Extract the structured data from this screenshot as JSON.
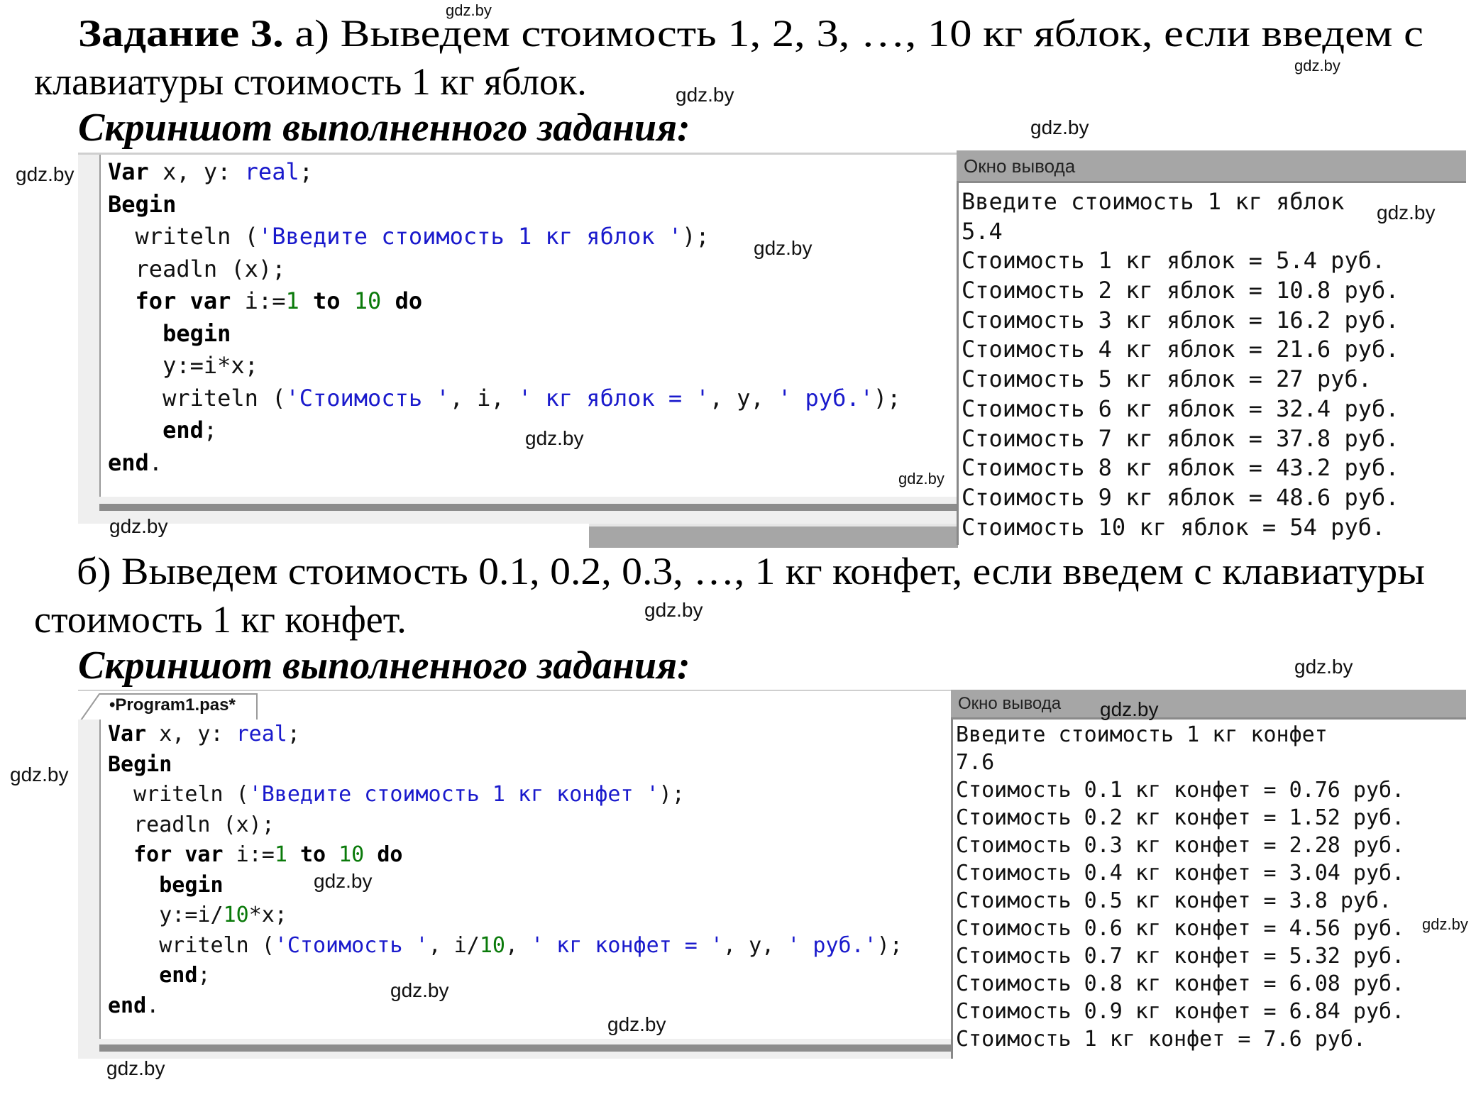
{
  "task": {
    "title_bold": "Задание 3.",
    "part_a_line1": " а) Выведем стоимость 1, 2, 3, …, 10 кг яблок, если введем с",
    "part_a_line2": "клавиатуры стоимость 1 кг яблок.",
    "screenshot_heading": "Скриншот выполненного задания:",
    "part_b_line1": "б) Выведем стоимость 0.1, 0.2, 0.3, …, 1 кг конфет, если введем с клавиатуры",
    "part_b_line2": "стоимость 1 кг конфет."
  },
  "watermark": "gdz.by",
  "section_a": {
    "code": [
      [
        {
          "t": "Var",
          "c": "kw"
        },
        {
          "t": " x, y: "
        },
        {
          "t": "real",
          "c": "typ"
        },
        {
          "t": ";"
        }
      ],
      [
        {
          "t": "Begin",
          "c": "kw"
        }
      ],
      [
        {
          "t": "  writeln ("
        },
        {
          "t": "'Введите стоимость 1 кг яблок '",
          "c": "str"
        },
        {
          "t": ");"
        }
      ],
      [
        {
          "t": "  readln (x);"
        }
      ],
      [
        {
          "t": "  "
        },
        {
          "t": "for var",
          "c": "kw"
        },
        {
          "t": " i:="
        },
        {
          "t": "1",
          "c": "num"
        },
        {
          "t": " "
        },
        {
          "t": "to",
          "c": "kw"
        },
        {
          "t": " "
        },
        {
          "t": "10",
          "c": "num"
        },
        {
          "t": " "
        },
        {
          "t": "do",
          "c": "kw"
        }
      ],
      [
        {
          "t": "    "
        },
        {
          "t": "begin",
          "c": "kw"
        }
      ],
      [
        {
          "t": "    y:=i*x;"
        }
      ],
      [
        {
          "t": "    writeln ("
        },
        {
          "t": "'Стоимость '",
          "c": "str"
        },
        {
          "t": ", i, "
        },
        {
          "t": "' кг яблок = '",
          "c": "str"
        },
        {
          "t": ", y, "
        },
        {
          "t": "' руб.'",
          "c": "str"
        },
        {
          "t": ");"
        }
      ],
      [
        {
          "t": "    "
        },
        {
          "t": "end",
          "c": "kw"
        },
        {
          "t": ";"
        }
      ],
      [
        {
          "t": "end",
          "c": "kw"
        },
        {
          "t": "."
        }
      ]
    ],
    "output_title": "Окно вывода",
    "output_lines": [
      "Введите стоимость 1 кг яблок",
      "5.4",
      "Стоимость 1 кг яблок = 5.4 руб.",
      "Стоимость 2 кг яблок = 10.8 руб.",
      "Стоимость 3 кг яблок = 16.2 руб.",
      "Стоимость 4 кг яблок = 21.6 руб.",
      "Стоимость 5 кг яблок = 27 руб.",
      "Стоимость 6 кг яблок = 32.4 руб.",
      "Стоимость 7 кг яблок = 37.8 руб.",
      "Стоимость 8 кг яблок = 43.2 руб.",
      "Стоимость 9 кг яблок = 48.6 руб.",
      "Стоимость 10 кг яблок = 54 руб."
    ]
  },
  "section_b": {
    "tab_label": "•Program1.pas*",
    "code": [
      [
        {
          "t": "Var",
          "c": "kw"
        },
        {
          "t": " x, y: "
        },
        {
          "t": "real",
          "c": "typ"
        },
        {
          "t": ";"
        }
      ],
      [
        {
          "t": "Begin",
          "c": "kw"
        }
      ],
      [
        {
          "t": "  writeln ("
        },
        {
          "t": "'Введите стоимость 1 кг конфет '",
          "c": "str"
        },
        {
          "t": ");"
        }
      ],
      [
        {
          "t": "  readln (x);"
        }
      ],
      [
        {
          "t": "  "
        },
        {
          "t": "for var",
          "c": "kw"
        },
        {
          "t": " i:="
        },
        {
          "t": "1",
          "c": "num"
        },
        {
          "t": " "
        },
        {
          "t": "to",
          "c": "kw"
        },
        {
          "t": " "
        },
        {
          "t": "10",
          "c": "num"
        },
        {
          "t": " "
        },
        {
          "t": "do",
          "c": "kw"
        }
      ],
      [
        {
          "t": "    "
        },
        {
          "t": "begin",
          "c": "kw"
        }
      ],
      [
        {
          "t": "    y:=i/"
        },
        {
          "t": "10",
          "c": "num"
        },
        {
          "t": "*x;"
        }
      ],
      [
        {
          "t": "    writeln ("
        },
        {
          "t": "'Стоимость '",
          "c": "str"
        },
        {
          "t": ", i/"
        },
        {
          "t": "10",
          "c": "num"
        },
        {
          "t": ", "
        },
        {
          "t": "' кг конфет = '",
          "c": "str"
        },
        {
          "t": ", y, "
        },
        {
          "t": "' руб.'",
          "c": "str"
        },
        {
          "t": ");"
        }
      ],
      [
        {
          "t": "    "
        },
        {
          "t": "end",
          "c": "kw"
        },
        {
          "t": ";"
        }
      ],
      [
        {
          "t": "end",
          "c": "kw"
        },
        {
          "t": "."
        }
      ]
    ],
    "output_title": "Окно вывода",
    "output_lines": [
      "Введите стоимость 1 кг конфет",
      "7.6",
      "Стоимость 0.1 кг конфет = 0.76 руб.",
      "Стоимость 0.2 кг конфет = 1.52 руб.",
      "Стоимость 0.3 кг конфет = 2.28 руб.",
      "Стоимость 0.4 кг конфет = 3.04 руб.",
      "Стоимость 0.5 кг конфет = 3.8 руб.",
      "Стоимость 0.6 кг конфет = 4.56 руб.",
      "Стоимость 0.7 кг конфет = 5.32 руб.",
      "Стоимость 0.8 кг конфет = 6.08 руб.",
      "Стоимость 0.9 кг конфет = 6.84 руб.",
      "Стоимость 1 кг конфет = 7.6 руб."
    ]
  }
}
